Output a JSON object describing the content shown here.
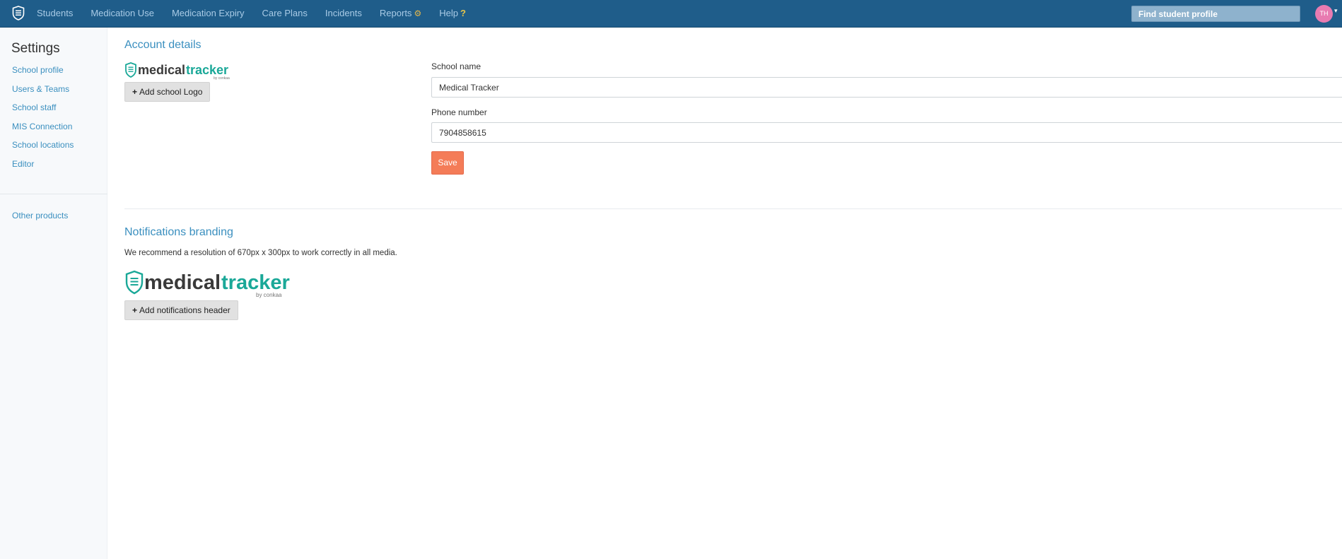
{
  "nav": {
    "logo_icon": "shield-list-icon",
    "items": [
      "Students",
      "Medication Use",
      "Medication Expiry",
      "Care Plans",
      "Incidents",
      "Reports",
      "Help"
    ],
    "reports_icon": "gear-icon",
    "help_icon": "question-icon",
    "search_placeholder": "Find student profile",
    "avatar_initials": "TH"
  },
  "sidebar": {
    "title": "Settings",
    "items": [
      "School profile",
      "Users & Teams",
      "School staff",
      "MIS Connection",
      "School locations",
      "Editor"
    ],
    "other_link": "Other products"
  },
  "account": {
    "title": "Account details",
    "add_logo_button": "Add school Logo",
    "school_name_label": "School name",
    "school_name_value": "Medical Tracker",
    "phone_label": "Phone number",
    "phone_value": "7904858615",
    "save_button": "Save"
  },
  "branding": {
    "title": "Notifications branding",
    "hint": "We recommend a resolution of 670px x 300px to work correctly in all media.",
    "add_header_button": "Add notifications header"
  },
  "logo": {
    "word1": "medical",
    "word2": "tracker",
    "tagline": "by conkaa"
  },
  "colors": {
    "topbar": "#1f5d8a",
    "link": "#3a8fbf",
    "save": "#f47c58",
    "brand_teal": "#1aa898",
    "brand_dark": "#3a3a3a"
  }
}
